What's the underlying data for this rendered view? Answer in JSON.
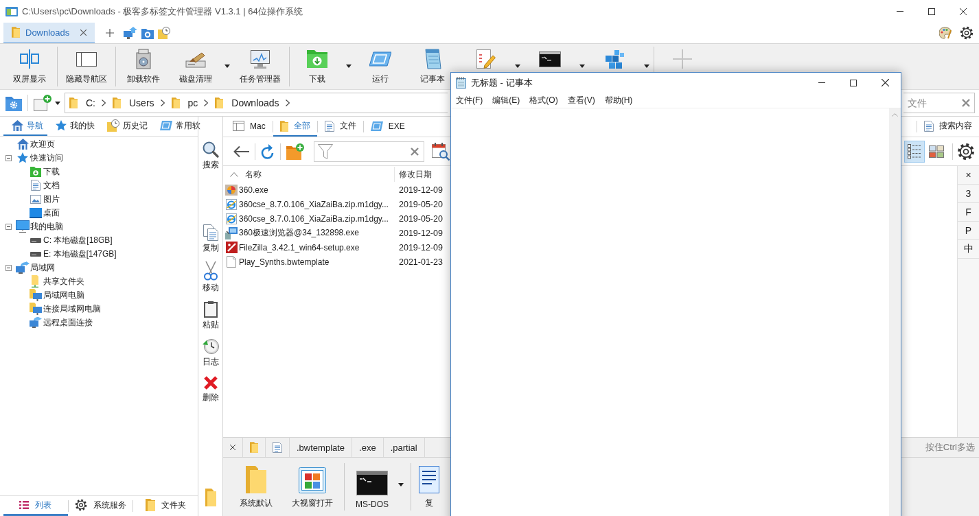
{
  "window": {
    "title": "C:\\Users\\pc\\Downloads - 极客多标签文件管理器 V1.3.1 | 64位操作系统"
  },
  "tabs": [
    {
      "label": "Downloads",
      "selected": true
    }
  ],
  "ribbon": {
    "groups": [
      [
        {
          "label": "双屏显示",
          "has_menu": false
        }
      ],
      [
        {
          "label": "隐藏导航区",
          "has_menu": false
        }
      ],
      [
        {
          "label": "卸载软件",
          "has_menu": false
        },
        {
          "label": "磁盘清理",
          "has_menu": true
        },
        {
          "label": "任务管理器",
          "has_menu": false
        }
      ],
      [
        {
          "label": "下载",
          "has_menu": true
        },
        {
          "label": "运行",
          "has_menu": false
        },
        {
          "label": "记事本",
          "has_menu": false
        },
        {
          "has_menu": true
        },
        {
          "has_menu": true
        },
        {
          "has_menu": true
        }
      ],
      [
        {
          "has_menu": false
        }
      ]
    ]
  },
  "address_bar": {
    "breadcrumb": [
      "C:",
      "Users",
      "pc",
      "Downloads"
    ],
    "search": {
      "placeholder": "文件"
    }
  },
  "nav_panel": {
    "tabs": [
      {
        "label": "导航",
        "selected": true
      },
      {
        "label": "我的快",
        "selected": false
      },
      {
        "label": "历史记",
        "selected": false
      },
      {
        "label": "常用软",
        "selected": false
      }
    ],
    "tree": [
      {
        "label": "欢迎页"
      },
      {
        "label": "快速访问",
        "expanded": true,
        "children": [
          {
            "label": "下载"
          },
          {
            "label": "文档"
          },
          {
            "label": "图片"
          },
          {
            "label": "桌面"
          }
        ]
      },
      {
        "label": "我的电脑",
        "expanded": true,
        "children": [
          {
            "label": "C: 本地磁盘[18GB]"
          },
          {
            "label": "E: 本地磁盘[147GB]"
          }
        ]
      },
      {
        "label": "局域网",
        "expanded": true,
        "children": [
          {
            "label": "共享文件夹"
          },
          {
            "label": "局域网电脑"
          },
          {
            "label": "连接局域网电脑"
          },
          {
            "label": "远程桌面连接"
          }
        ]
      }
    ],
    "bottom_tabs": [
      {
        "label": "列表",
        "selected": true
      },
      {
        "label": "系统服务",
        "selected": false
      },
      {
        "label": "文件夹",
        "selected": false
      }
    ]
  },
  "actions": [
    "搜索",
    "复制",
    "移动",
    "粘贴",
    "日志",
    "删除"
  ],
  "file_pane": {
    "filter_tabs": [
      {
        "label": "Mac",
        "selected": false
      },
      {
        "label": "全部",
        "selected": true
      },
      {
        "label": "文件",
        "selected": false
      },
      {
        "label": "EXE",
        "selected": false
      },
      {
        "label": "搜索内容",
        "selected": false
      }
    ],
    "view_modes": [
      {
        "selected": true
      },
      {
        "selected": false
      }
    ],
    "columns": [
      "名称",
      "修改日期"
    ],
    "rows": [
      {
        "name": "360.exe",
        "modified": "2019-12-09"
      },
      {
        "name": "360cse_8.7.0.106_XiaZaiBa.zip.m1dgy...",
        "modified": "2019-05-20"
      },
      {
        "name": "360cse_8.7.0.106_XiaZaiBa.zip.m1dgy...",
        "modified": "2019-05-20"
      },
      {
        "name": "360极速浏览器@34_132898.exe",
        "modified": "2019-12-09"
      },
      {
        "name": "FileZilla_3.42.1_win64-setup.exe",
        "modified": "2019-12-09"
      },
      {
        "name": "Play_Synths.bwtemplate",
        "modified": "2021-01-23"
      }
    ],
    "index": [
      "×",
      "3",
      "F",
      "P",
      "中"
    ],
    "extension_filters": [
      ".bwtemplate",
      ".exe",
      ".partial"
    ],
    "hint": "按住Ctrl多选",
    "launchers": [
      [
        {
          "label": "系统默认",
          "has_menu": false
        },
        {
          "label": "大视窗打开",
          "has_menu": false
        }
      ],
      [
        {
          "label": "MS-DOS",
          "has_menu": true
        }
      ],
      [
        {
          "label": "复",
          "has_menu": false
        }
      ]
    ]
  },
  "notepad": {
    "title": "无标题 - 记事本",
    "menu": [
      "文件(F)",
      "编辑(E)",
      "格式(O)",
      "查看(V)",
      "帮助(H)"
    ]
  }
}
